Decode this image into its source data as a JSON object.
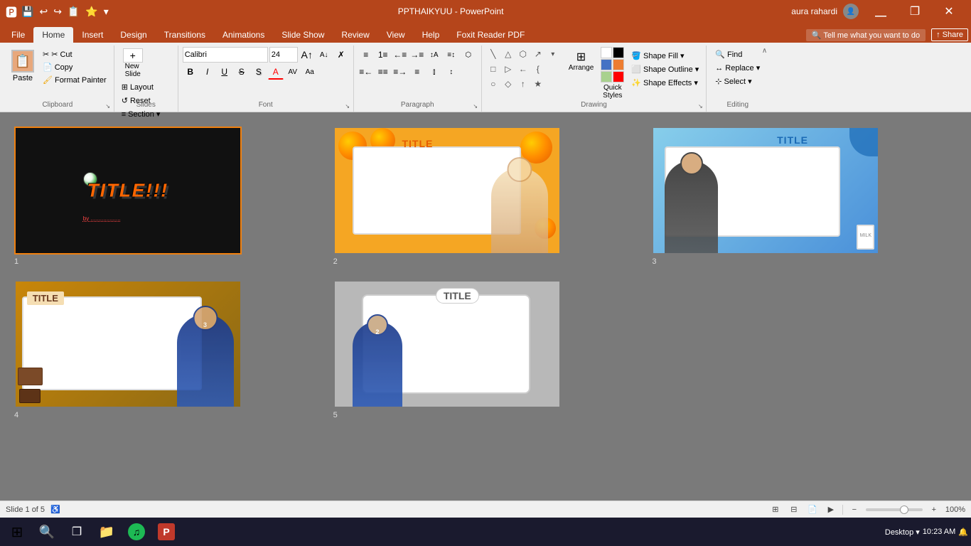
{
  "titleBar": {
    "title": "PPTHAIKYUU - PowerPoint",
    "user": "aura rahardi",
    "quickAccessIcons": [
      "💾",
      "↩",
      "↪",
      "📋",
      "⭐",
      "▾"
    ]
  },
  "ribbonTabs": {
    "active": "Home",
    "tabs": [
      "File",
      "Home",
      "Insert",
      "Design",
      "Transitions",
      "Animations",
      "Slide Show",
      "Review",
      "View",
      "Help",
      "Foxit Reader PDF"
    ]
  },
  "ribbon": {
    "clipboardGroup": {
      "label": "Clipboard",
      "paste": "Paste",
      "cut": "✂ Cut",
      "copy": "📋 Copy",
      "formatPainter": "🖌 Format Painter"
    },
    "slidesGroup": {
      "label": "Slides",
      "newSlide": "New\nSlide",
      "layout": "Layout",
      "reset": "Reset",
      "section": "Section"
    },
    "fontGroup": {
      "label": "Font",
      "fontName": "Calibri",
      "fontSize": "24",
      "bold": "B",
      "italic": "I",
      "underline": "U",
      "strikethrough": "S",
      "shadow": "S",
      "fontColor": "A",
      "increaseFont": "A↑",
      "decreaseFont": "A↓",
      "clearFormat": "✗"
    },
    "paragraphGroup": {
      "label": "Paragraph"
    },
    "drawingGroup": {
      "label": "Drawing",
      "shapes": [
        "□",
        "○",
        "△",
        "▷",
        "◇",
        "⬡",
        "←",
        "↑",
        "↗",
        "⤴",
        "〔",
        "★"
      ]
    },
    "arrangeFill": {
      "arrange": "Arrange",
      "quickStyles": "Quick\nStyles",
      "shapeFill": "Shape Fill ▾",
      "shapeOutline": "Shape Outline ▾",
      "shapeEffects": "Shape Effects ▾"
    },
    "editingGroup": {
      "label": "Editing",
      "find": "🔍 Find",
      "replace": "Replace ▾",
      "select": "Select ▾"
    }
  },
  "slides": [
    {
      "num": "1",
      "theme": "dark",
      "title": "TITLE!!!",
      "selected": true
    },
    {
      "num": "2",
      "theme": "orange",
      "title": "TITLE",
      "selected": false
    },
    {
      "num": "3",
      "theme": "blue",
      "title": "TITLE",
      "selected": false
    },
    {
      "num": "4",
      "theme": "chocolate",
      "title": "TITLE",
      "selected": false
    },
    {
      "num": "5",
      "theme": "grey",
      "title": "TITLE",
      "selected": false
    }
  ],
  "statusBar": {
    "slideInfo": "Slide 1 of 5",
    "zoom": "100%"
  },
  "taskbar": {
    "time": "10:23 AM",
    "desktopLabel": "Desktop"
  }
}
